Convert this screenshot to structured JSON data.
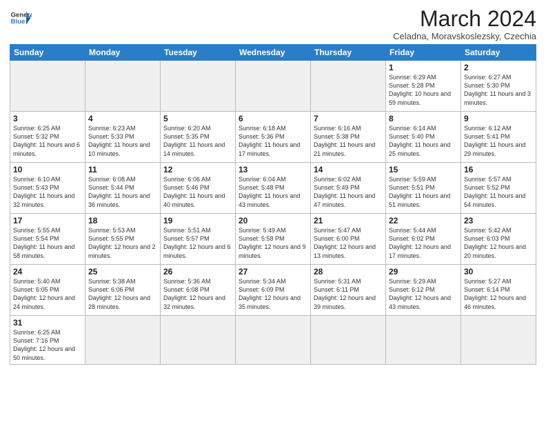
{
  "header": {
    "logo_general": "General",
    "logo_blue": "Blue",
    "month_year": "March 2024",
    "location": "Celadna, Moravskoslezsky, Czechia"
  },
  "weekdays": [
    "Sunday",
    "Monday",
    "Tuesday",
    "Wednesday",
    "Thursday",
    "Friday",
    "Saturday"
  ],
  "weeks": [
    [
      {
        "num": "",
        "info": ""
      },
      {
        "num": "",
        "info": ""
      },
      {
        "num": "",
        "info": ""
      },
      {
        "num": "",
        "info": ""
      },
      {
        "num": "",
        "info": ""
      },
      {
        "num": "1",
        "info": "Sunrise: 6:29 AM\nSunset: 5:28 PM\nDaylight: 10 hours and 59 minutes."
      },
      {
        "num": "2",
        "info": "Sunrise: 6:27 AM\nSunset: 5:30 PM\nDaylight: 11 hours and 3 minutes."
      }
    ],
    [
      {
        "num": "3",
        "info": "Sunrise: 6:25 AM\nSunset: 5:32 PM\nDaylight: 11 hours and 6 minutes."
      },
      {
        "num": "4",
        "info": "Sunrise: 6:23 AM\nSunset: 5:33 PM\nDaylight: 11 hours and 10 minutes."
      },
      {
        "num": "5",
        "info": "Sunrise: 6:20 AM\nSunset: 5:35 PM\nDaylight: 11 hours and 14 minutes."
      },
      {
        "num": "6",
        "info": "Sunrise: 6:18 AM\nSunset: 5:36 PM\nDaylight: 11 hours and 17 minutes."
      },
      {
        "num": "7",
        "info": "Sunrise: 6:16 AM\nSunset: 5:38 PM\nDaylight: 11 hours and 21 minutes."
      },
      {
        "num": "8",
        "info": "Sunrise: 6:14 AM\nSunset: 5:40 PM\nDaylight: 11 hours and 25 minutes."
      },
      {
        "num": "9",
        "info": "Sunrise: 6:12 AM\nSunset: 5:41 PM\nDaylight: 11 hours and 29 minutes."
      }
    ],
    [
      {
        "num": "10",
        "info": "Sunrise: 6:10 AM\nSunset: 5:43 PM\nDaylight: 11 hours and 32 minutes."
      },
      {
        "num": "11",
        "info": "Sunrise: 6:08 AM\nSunset: 5:44 PM\nDaylight: 11 hours and 36 minutes."
      },
      {
        "num": "12",
        "info": "Sunrise: 6:06 AM\nSunset: 5:46 PM\nDaylight: 11 hours and 40 minutes."
      },
      {
        "num": "13",
        "info": "Sunrise: 6:04 AM\nSunset: 5:48 PM\nDaylight: 11 hours and 43 minutes."
      },
      {
        "num": "14",
        "info": "Sunrise: 6:02 AM\nSunset: 5:49 PM\nDaylight: 11 hours and 47 minutes."
      },
      {
        "num": "15",
        "info": "Sunrise: 5:59 AM\nSunset: 5:51 PM\nDaylight: 11 hours and 51 minutes."
      },
      {
        "num": "16",
        "info": "Sunrise: 5:57 AM\nSunset: 5:52 PM\nDaylight: 11 hours and 54 minutes."
      }
    ],
    [
      {
        "num": "17",
        "info": "Sunrise: 5:55 AM\nSunset: 5:54 PM\nDaylight: 11 hours and 58 minutes."
      },
      {
        "num": "18",
        "info": "Sunrise: 5:53 AM\nSunset: 5:55 PM\nDaylight: 12 hours and 2 minutes."
      },
      {
        "num": "19",
        "info": "Sunrise: 5:51 AM\nSunset: 5:57 PM\nDaylight: 12 hours and 6 minutes."
      },
      {
        "num": "20",
        "info": "Sunrise: 5:49 AM\nSunset: 5:58 PM\nDaylight: 12 hours and 9 minutes."
      },
      {
        "num": "21",
        "info": "Sunrise: 5:47 AM\nSunset: 6:00 PM\nDaylight: 12 hours and 13 minutes."
      },
      {
        "num": "22",
        "info": "Sunrise: 5:44 AM\nSunset: 6:02 PM\nDaylight: 12 hours and 17 minutes."
      },
      {
        "num": "23",
        "info": "Sunrise: 5:42 AM\nSunset: 6:03 PM\nDaylight: 12 hours and 20 minutes."
      }
    ],
    [
      {
        "num": "24",
        "info": "Sunrise: 5:40 AM\nSunset: 6:05 PM\nDaylight: 12 hours and 24 minutes."
      },
      {
        "num": "25",
        "info": "Sunrise: 5:38 AM\nSunset: 6:06 PM\nDaylight: 12 hours and 28 minutes."
      },
      {
        "num": "26",
        "info": "Sunrise: 5:36 AM\nSunset: 6:08 PM\nDaylight: 12 hours and 32 minutes."
      },
      {
        "num": "27",
        "info": "Sunrise: 5:34 AM\nSunset: 6:09 PM\nDaylight: 12 hours and 35 minutes."
      },
      {
        "num": "28",
        "info": "Sunrise: 5:31 AM\nSunset: 6:11 PM\nDaylight: 12 hours and 39 minutes."
      },
      {
        "num": "29",
        "info": "Sunrise: 5:29 AM\nSunset: 6:12 PM\nDaylight: 12 hours and 43 minutes."
      },
      {
        "num": "30",
        "info": "Sunrise: 5:27 AM\nSunset: 6:14 PM\nDaylight: 12 hours and 46 minutes."
      }
    ],
    [
      {
        "num": "31",
        "info": "Sunrise: 6:25 AM\nSunset: 7:16 PM\nDaylight: 12 hours and 50 minutes."
      },
      {
        "num": "",
        "info": ""
      },
      {
        "num": "",
        "info": ""
      },
      {
        "num": "",
        "info": ""
      },
      {
        "num": "",
        "info": ""
      },
      {
        "num": "",
        "info": ""
      },
      {
        "num": "",
        "info": ""
      }
    ]
  ]
}
